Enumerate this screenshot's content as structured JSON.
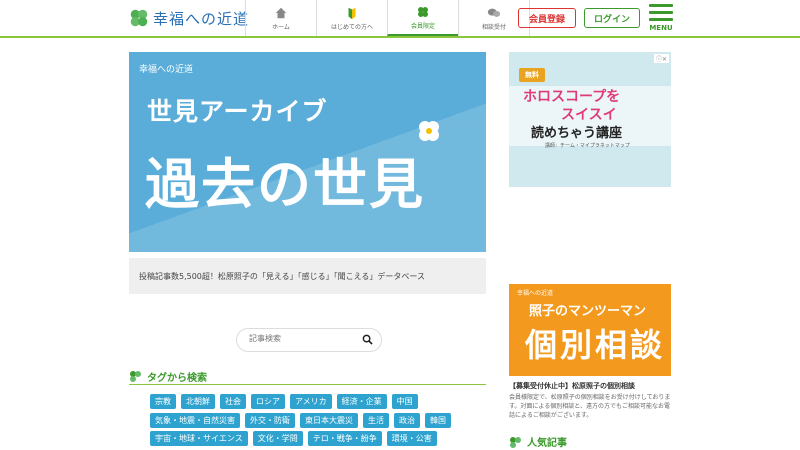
{
  "header": {
    "logo_text": "幸福への近道",
    "nav": [
      {
        "label": "ホーム",
        "icon": "home-icon"
      },
      {
        "label": "はじめての方へ",
        "icon": "beginner-icon"
      },
      {
        "label": "会員限定",
        "icon": "clover-icon",
        "active": true
      },
      {
        "label": "相談受付",
        "icon": "chat-icon"
      }
    ],
    "register_label": "会員登録",
    "login_label": "ログイン",
    "menu_label": "MENU"
  },
  "hero": {
    "logo_text": "幸福への近道",
    "subtitle": "世見アーカイブ",
    "title": "過去の世見",
    "caption": "投稿記事数5,500超！松原照子の「見える」「感じる」「聞こえる」データベース"
  },
  "search": {
    "placeholder": "記事検索"
  },
  "tags": {
    "heading": "タグから検索",
    "rows": [
      [
        "宗教",
        "北朝鮮",
        "社会",
        "ロシア",
        "アメリカ",
        "経済・企業",
        "中国"
      ],
      [
        "気象・地震・自然災害",
        "外交・防衛",
        "東日本大震災",
        "生活",
        "政治",
        "韓国"
      ],
      [
        "宇宙・地球・サイエンス",
        "文化・学問",
        "テロ・戦争・紛争",
        "環境・公害"
      ]
    ]
  },
  "ad": {
    "ad_tag": "ⓘ✕",
    "free_badge": "無料",
    "line1": "ホロスコープを",
    "line2": "スイスイ",
    "line3": "読めちゃう講座",
    "line4": "講師：チーム・マイプラネットマップ"
  },
  "consult": {
    "logo_text": "幸福への近道",
    "line1": "照子のマンツーマン",
    "line2": "個別相談",
    "title": "【募集受付休止中】松原照子の個別相談",
    "body": "会員様限定で、松原照子の個別相談をお受け付けしております。対面による個別相談と、遠方の方でもご相談可能なお電話によるご相談がございます。"
  },
  "popular": {
    "heading": "人気記事"
  },
  "colors": {
    "brand_green": "#3b9a2b",
    "tag_blue": "#2fa3cf",
    "hero_blue": "#5aadd8",
    "consult_orange": "#f39a1e",
    "register_red": "#dd3333"
  }
}
